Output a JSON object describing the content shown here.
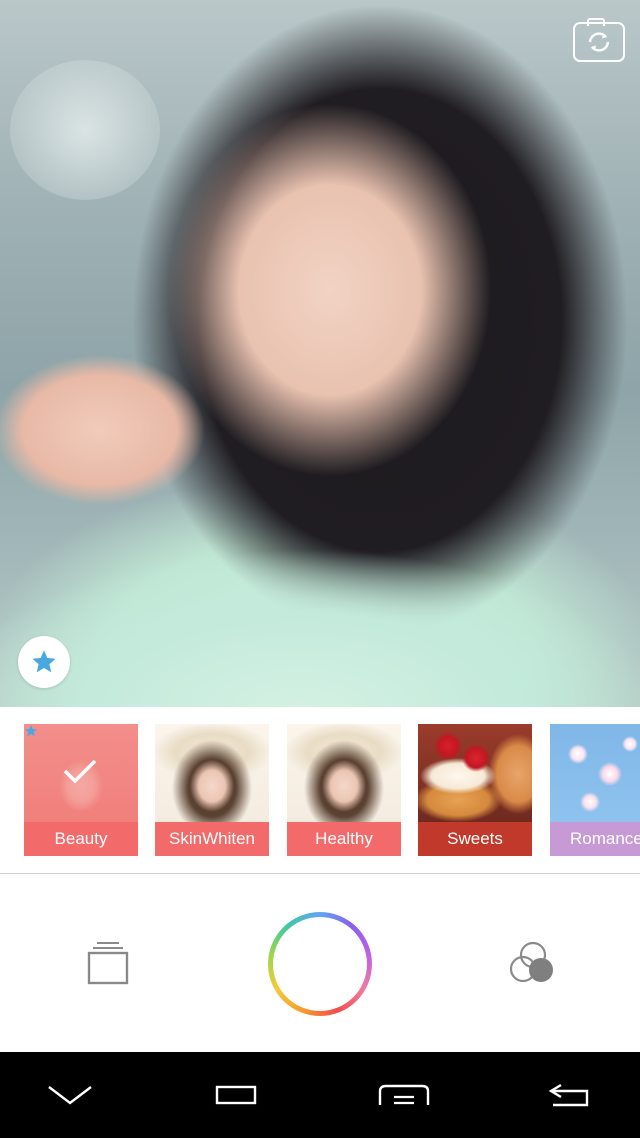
{
  "preview": {
    "camera_switch_icon": "camera-switch-icon",
    "favorite_icon": "star-icon"
  },
  "filters": [
    {
      "label": "Beauty",
      "label_color": "#f26a6a",
      "selected": true,
      "favorite": true
    },
    {
      "label": "SkinWhiten",
      "label_color": "#f26a6a",
      "selected": false
    },
    {
      "label": "Healthy",
      "label_color": "#f26a6a",
      "selected": false
    },
    {
      "label": "Sweets",
      "label_color": "#c0392b",
      "selected": false
    },
    {
      "label": "Romance",
      "label_color": "#c79ad6",
      "selected": false
    }
  ],
  "controls": {
    "gallery_icon": "gallery-stack-icon",
    "shutter": "shutter-ring",
    "effects_icon": "overlapping-circles-icon"
  },
  "navbar": {
    "items": [
      "chevron-down-icon",
      "recent-apps-icon",
      "menu-icon",
      "back-icon"
    ]
  },
  "colors": {
    "accent_star": "#4aa8e0",
    "filter_red": "#f26a6a",
    "sweets_red": "#c0392b",
    "romance_purple": "#c79ad6"
  }
}
